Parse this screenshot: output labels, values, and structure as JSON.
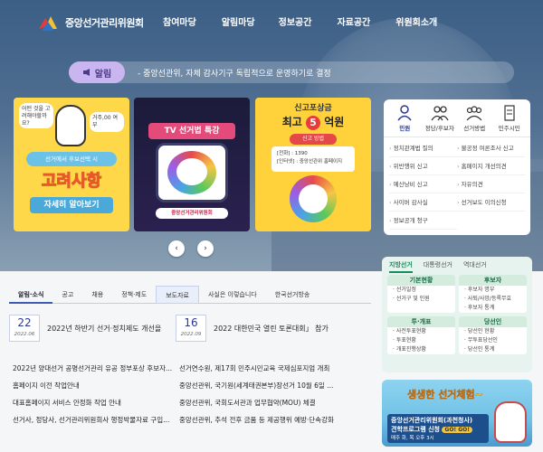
{
  "header": {
    "logo_text": "중앙선거관리위원회",
    "nav": [
      "참여마당",
      "알림마당",
      "정보공간",
      "자료공간",
      "위원회소개"
    ]
  },
  "alert": {
    "pill_label": "알림",
    "message": "- 중앙선관위, 자체 감사기구 독립적으로 운영하기로 결정"
  },
  "banner1": {
    "bubble_left": "어떤 것을 고려해야할까요?",
    "bubble_right": "거주,00 여부",
    "label": "선거에서 후보선택 시",
    "title": "고려사항",
    "button": "자세히 알아보기"
  },
  "banner2": {
    "ribbon": "TV 선거법 특강",
    "logo": "중앙선거관리위원회"
  },
  "banner3": {
    "top": "신고포상금",
    "title_pre": "최고",
    "title_num": "5",
    "title_post": "억원",
    "how": "신고 방법",
    "line1": "[전화] : 1390",
    "line2": "[인터넷] : 중앙선관위 홈페이지"
  },
  "slider": {
    "prev": "‹",
    "next": "›"
  },
  "quick_menu": {
    "tabs": [
      {
        "label": "민원",
        "icon": "person-icon"
      },
      {
        "label": "정당/후보자",
        "icon": "people-icon"
      },
      {
        "label": "선거방법",
        "icon": "group-icon"
      },
      {
        "label": "민주시민",
        "icon": "document-icon"
      }
    ],
    "links": [
      "정치관계법 질의",
      "불공정 여론조사 신고",
      "위반행위 신고",
      "홈페이지 개선의견",
      "예산낭비 신고",
      "자유의견",
      "사이버 감사실",
      "선거보도 이의신청",
      "정보공개 청구"
    ]
  },
  "news": {
    "tabs": [
      "알림·소식",
      "공고",
      "채용",
      "정책·제도",
      "보도자료",
      "사실은 이렇습니다",
      "한국선거방송"
    ],
    "featured": [
      {
        "day": "22",
        "ym": "2022.06",
        "title": "2022년 하반기 선거·정치제도 개선을"
      },
      {
        "day": "16",
        "ym": "2022.09",
        "title": "2022 대한민국 열린 토론대회」 참가"
      }
    ],
    "left_items": [
      "2022년 양대선거 공명선거관리 유공 정부포상 후보자...",
      "홈페이지 이전 작업안내",
      "대표홈페이지 서비스 안정화 작업 안내",
      "선거사, 정당사, 선거관리위원회사 행정박물자료 구입..."
    ],
    "right_items": [
      "선거연수원, 제17회 민주시민교육 국제심포지엄 개최",
      "중앙선관위, 국기원(세계태권본부)장선거 10월 6일 ...",
      "중앙선관위, 국회도서관과 업무협약(MOU) 체결",
      "중앙선관위, 추석 전후 금품 등 제공행위 예방·단속강화"
    ]
  },
  "side_panel": {
    "tabs": [
      "지방선거",
      "대통령선거",
      "역대선거"
    ],
    "groups": [
      {
        "title": "기본현황",
        "links": [
          "선거일정",
          "선거구 및 인원"
        ]
      },
      {
        "title": "후보자",
        "links": [
          "후보자 명부",
          "사퇴/사망/등록무효",
          "후보자 통계"
        ]
      },
      {
        "title": "투·개표",
        "links": [
          "사전투표현황",
          "투표현황",
          "개표진행상황"
        ]
      },
      {
        "title": "당선인",
        "links": [
          "당선인 현황",
          "무투표당선인",
          "당선인 통계"
        ]
      }
    ]
  },
  "promo": {
    "title": "생생한 선거체험~",
    "line1": "중앙선거관리위원회(과천청사)",
    "line2": "견학프로그램 신청",
    "go": "GO! GO!",
    "line3": "매주 화, 목 오후 3시"
  },
  "colors": {
    "hero_top": "#3c5f86",
    "alert_pill": "#c9b6f0",
    "accent_blue": "#3b5bb4",
    "panel_green": "#e7f3ee"
  }
}
